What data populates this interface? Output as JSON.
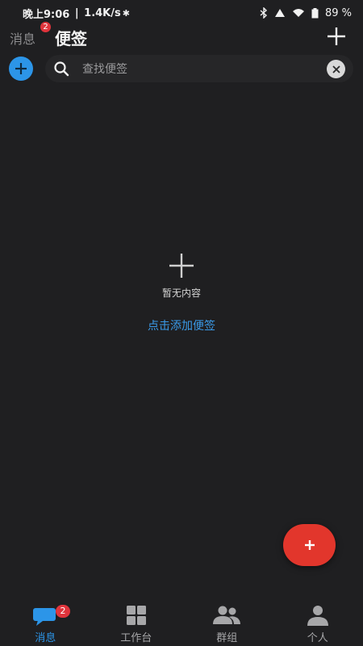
{
  "status_bar": {
    "time": "晚上9:06",
    "speed": "1.4K/s",
    "battery": "89 %"
  },
  "header": {
    "messages_tab": "消息",
    "messages_badge": "2",
    "title": "便签"
  },
  "search": {
    "placeholder": "查找便签"
  },
  "empty_state": {
    "text": "暂无内容",
    "link": "点击添加便签"
  },
  "bottom_nav": {
    "items": [
      {
        "label": "消息",
        "badge": "2",
        "active": true
      },
      {
        "label": "工作台"
      },
      {
        "label": "群组"
      },
      {
        "label": "个人"
      }
    ]
  },
  "colors": {
    "background": "#1f1f21",
    "accent_blue": "#2c95e8",
    "fab_red": "#e2362c",
    "badge_red": "#e0343c"
  },
  "icons": {
    "fab": "plus-icon",
    "header_add": "plus-icon",
    "search": "search-icon",
    "clear": "close-icon"
  }
}
